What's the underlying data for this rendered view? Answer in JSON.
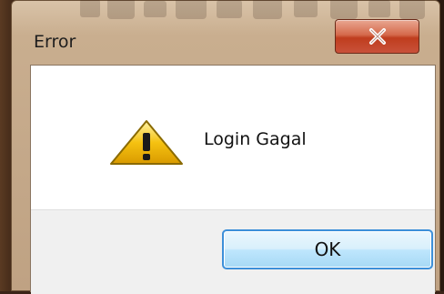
{
  "window": {
    "title": "Error",
    "close_glyph": "✕"
  },
  "dialog": {
    "icon": "warning-icon",
    "message": "Login Gagal",
    "ok_label": "OK"
  },
  "colors": {
    "accent": "#3c8fd9",
    "close_button": "#c9513a",
    "warning_yellow": "#f5c211"
  }
}
